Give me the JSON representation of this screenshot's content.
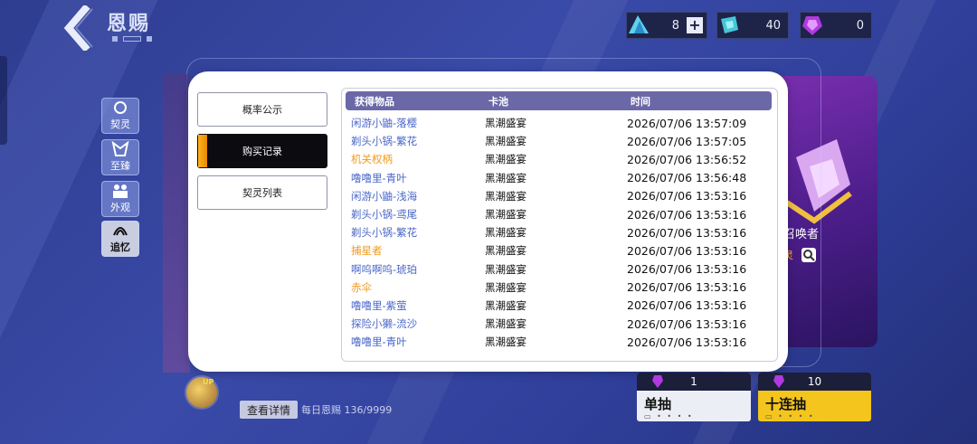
{
  "header": {
    "title": "恩赐"
  },
  "currencies": [
    {
      "icon": "blue-crystal-icon",
      "value": "8",
      "has_plus": true
    },
    {
      "icon": "teal-gem-icon",
      "value": "40",
      "has_plus": false
    },
    {
      "icon": "purple-gem-icon",
      "value": "0",
      "has_plus": false
    }
  ],
  "side_tabs": [
    {
      "label": "契灵"
    },
    {
      "label": "至臻"
    },
    {
      "label": "外观"
    },
    {
      "label": "追忆"
    }
  ],
  "menu": {
    "prob_label": "概率公示",
    "records_label": "购买记录",
    "list_label": "契灵列表"
  },
  "table": {
    "headers": [
      "获得物品",
      "卡池",
      "时间"
    ],
    "rows": [
      {
        "item": "闲游小鼬-落樱",
        "pool": "黑潮盛宴",
        "time": "2026/07/06 13:57:09",
        "rarity": "blue"
      },
      {
        "item": "剃头小锅-繁花",
        "pool": "黑潮盛宴",
        "time": "2026/07/06 13:57:05",
        "rarity": "blue"
      },
      {
        "item": "机关权柄",
        "pool": "黑潮盛宴",
        "time": "2026/07/06 13:56:52",
        "rarity": "orange"
      },
      {
        "item": "噜噜里-青叶",
        "pool": "黑潮盛宴",
        "time": "2026/07/06 13:56:48",
        "rarity": "blue"
      },
      {
        "item": "闲游小鼬-浅海",
        "pool": "黑潮盛宴",
        "time": "2026/07/06 13:53:16",
        "rarity": "blue"
      },
      {
        "item": "剃头小锅-鸢尾",
        "pool": "黑潮盛宴",
        "time": "2026/07/06 13:53:16",
        "rarity": "blue"
      },
      {
        "item": "剃头小锅-繁花",
        "pool": "黑潮盛宴",
        "time": "2026/07/06 13:53:16",
        "rarity": "blue"
      },
      {
        "item": "捕星者",
        "pool": "黑潮盛宴",
        "time": "2026/07/06 13:53:16",
        "rarity": "orange"
      },
      {
        "item": "啊呜啊呜-琥珀",
        "pool": "黑潮盛宴",
        "time": "2026/07/06 13:53:16",
        "rarity": "blue"
      },
      {
        "item": "赤伞",
        "pool": "黑潮盛宴",
        "time": "2026/07/06 13:53:16",
        "rarity": "orange"
      },
      {
        "item": "噜噜里-紫萤",
        "pool": "黑潮盛宴",
        "time": "2026/07/06 13:53:16",
        "rarity": "blue"
      },
      {
        "item": "探险小獭-流沙",
        "pool": "黑潮盛宴",
        "time": "2026/07/06 13:53:16",
        "rarity": "blue"
      },
      {
        "item": "噜噜里-青叶",
        "pool": "黑潮盛宴",
        "time": "2026/07/06 13:53:16",
        "rarity": "blue"
      }
    ]
  },
  "promo": {
    "text": "召唤者",
    "sub": "灵"
  },
  "bottom": {
    "up_badge": "UP",
    "detail_label": "查看详情",
    "daily_text": "每日恩赐 136/9999"
  },
  "draws": {
    "single": {
      "count": "1",
      "label": "单抽"
    },
    "ten": {
      "count": "10",
      "label": "十连抽"
    }
  },
  "colors": {
    "accent_orange": "#f09a1e",
    "item_blue": "#4a67c8",
    "header_purple": "#6b68a8"
  }
}
